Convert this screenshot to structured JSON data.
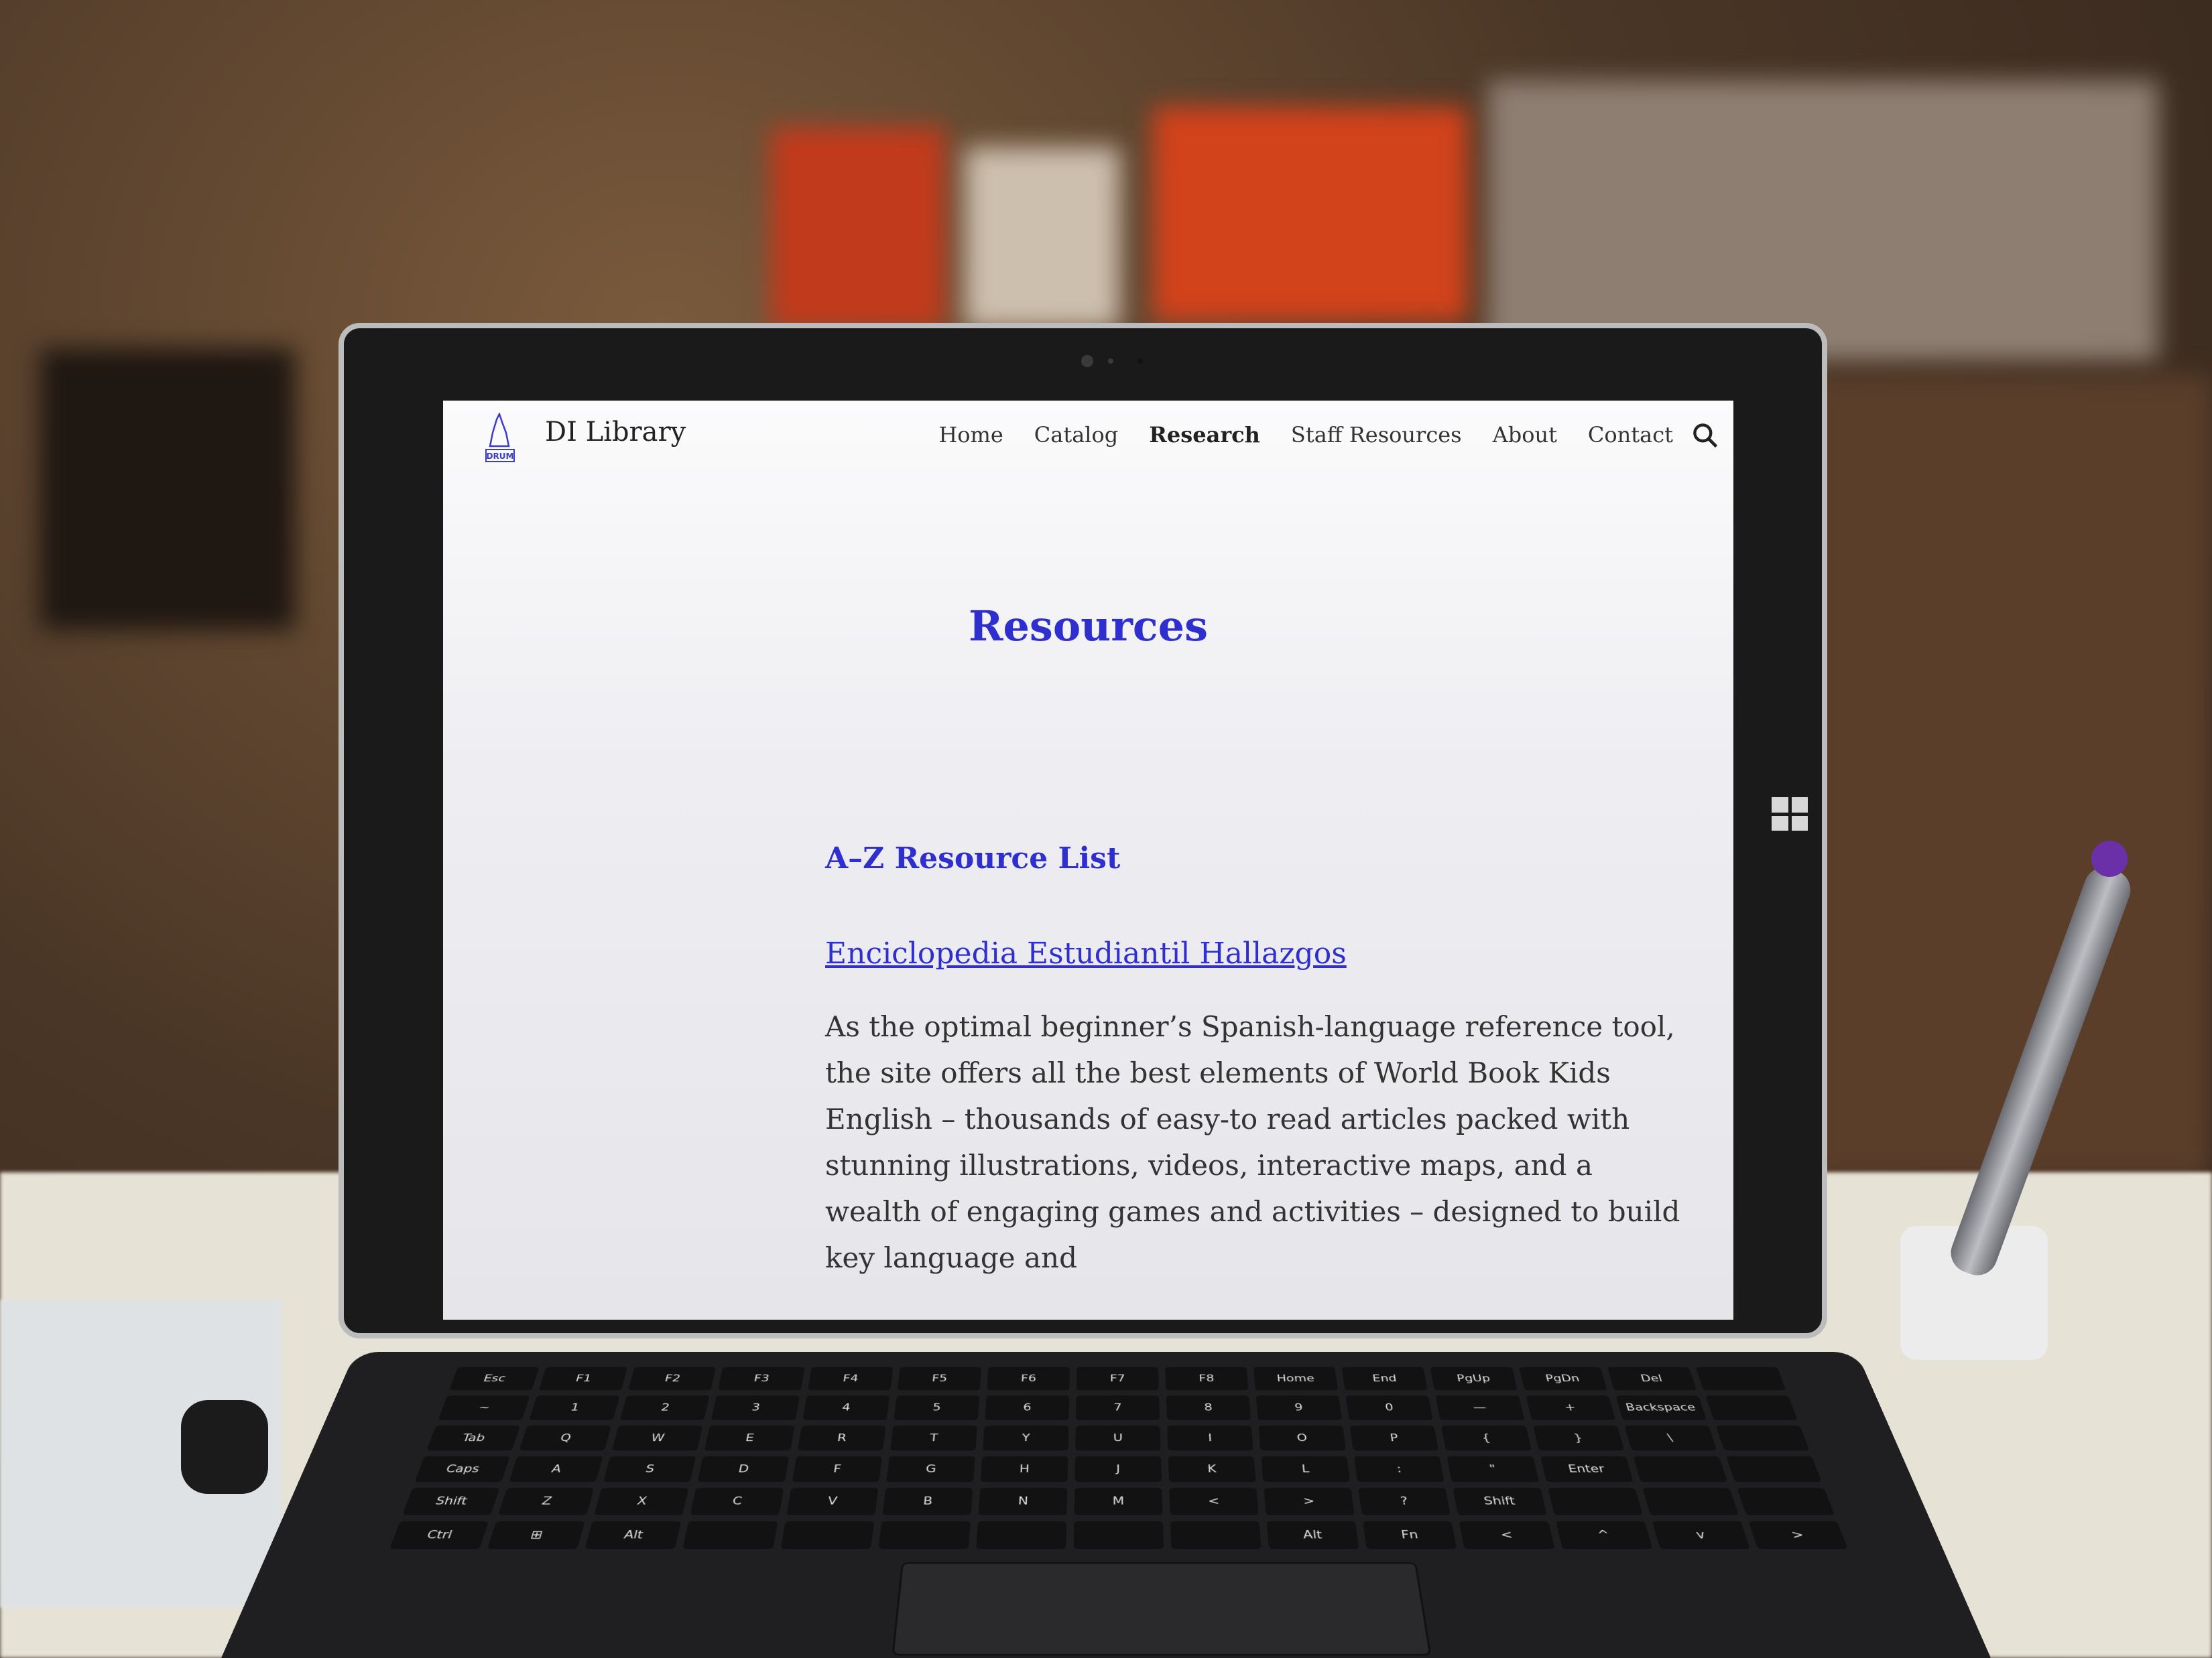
{
  "site": {
    "title": "DI Library",
    "logo_text": "DRUM"
  },
  "nav": {
    "items": [
      {
        "label": "Home",
        "active": false
      },
      {
        "label": "Catalog",
        "active": false
      },
      {
        "label": "Research",
        "active": true
      },
      {
        "label": "Staff Resources",
        "active": false
      },
      {
        "label": "About",
        "active": false
      },
      {
        "label": "Contact",
        "active": false
      }
    ]
  },
  "page": {
    "title": "Resources",
    "section_heading": "A–Z Resource List",
    "resource": {
      "link_text": "Enciclopedia Estudiantil Hallazgos",
      "description": "As the optimal beginner’s Spanish-language reference tool, the site offers all the best elements of World Book Kids English – thousands of easy-to read articles packed with stunning illustrations, videos, interactive maps, and a wealth of engaging games and activities – designed to build key language and"
    }
  },
  "keyboard": {
    "rows": [
      [
        "Esc",
        "F1",
        "F2",
        "F3",
        "F4",
        "F5",
        "F6",
        "F7",
        "F8",
        "Home",
        "End",
        "PgUp",
        "PgDn",
        "Del",
        ""
      ],
      [
        "~",
        "1",
        "2",
        "3",
        "4",
        "5",
        "6",
        "7",
        "8",
        "9",
        "0",
        "—",
        "+",
        "Backspace",
        ""
      ],
      [
        "Tab",
        "Q",
        "W",
        "E",
        "R",
        "T",
        "Y",
        "U",
        "I",
        "O",
        "P",
        "{",
        "}",
        "\\",
        ""
      ],
      [
        "Caps",
        "A",
        "S",
        "D",
        "F",
        "G",
        "H",
        "J",
        "K",
        "L",
        ":",
        "\"",
        "Enter",
        "",
        ""
      ],
      [
        "Shift",
        "Z",
        "X",
        "C",
        "V",
        "B",
        "N",
        "M",
        "<",
        ">",
        "?",
        "Shift",
        "",
        "",
        ""
      ],
      [
        "Ctrl",
        "⊞",
        "Alt",
        "",
        "",
        "",
        "",
        "",
        "",
        "Alt",
        "Fn",
        "<",
        "^",
        "v",
        ">"
      ]
    ]
  },
  "colors": {
    "accent": "#2f2fd0",
    "text": "#333333"
  },
  "icons": {
    "search": "search-icon",
    "windows": "windows-logo-icon"
  }
}
